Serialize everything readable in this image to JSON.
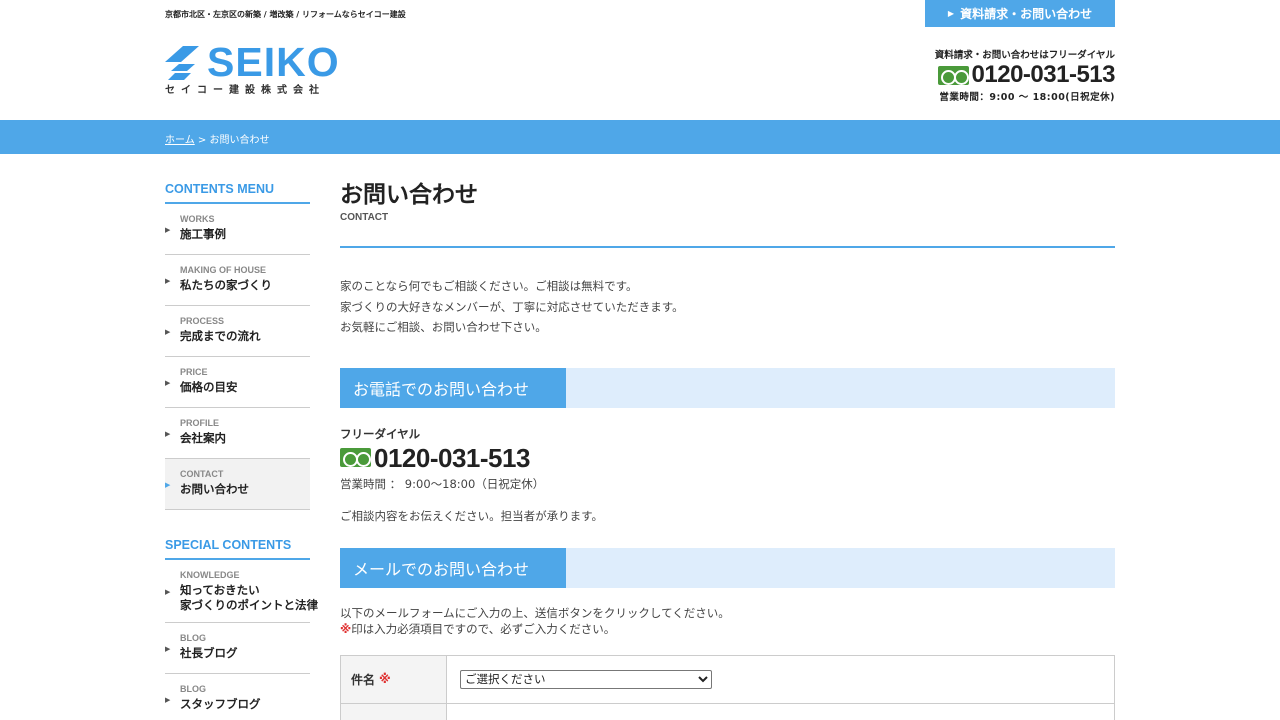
{
  "header": {
    "tagline": "京都市北区・左京区の新築 / 増改築 / リフォームならセイコー建設",
    "logo_word": "SEIKO",
    "logo_sub": "セイコー建設株式会社",
    "cta_button": "資料請求・お問い合わせ",
    "phone_lead": "資料請求・お問い合わせはフリーダイヤル",
    "phone_number": "0120-031-513",
    "phone_hours": "営業時間：9:00 〜 18:00(日祝定休)"
  },
  "breadcrumb": {
    "home": "ホーム",
    "separator": " > ",
    "current": "お問い合わせ"
  },
  "sidebar": {
    "contents_title": "CONTENTS MENU",
    "contents": [
      {
        "en": "WORKS",
        "jp": "施工事例"
      },
      {
        "en": "MAKING OF HOUSE",
        "jp": "私たちの家づくり"
      },
      {
        "en": "PROCESS",
        "jp": "完成までの流れ"
      },
      {
        "en": "PRICE",
        "jp": "価格の目安"
      },
      {
        "en": "PROFILE",
        "jp": "会社案内"
      },
      {
        "en": "CONTACT",
        "jp": "お問い合わせ"
      }
    ],
    "special_title": "SPECIAL CONTENTS",
    "special": [
      {
        "en": "KNOWLEDGE",
        "jp1": "知っておきたい",
        "jp2": "家づくりのポイントと法律"
      },
      {
        "en": "BLOG",
        "jp": "社長ブログ"
      },
      {
        "en": "BLOG",
        "jp": "スタッフブログ"
      }
    ]
  },
  "main": {
    "title": "お問い合わせ",
    "subtitle": "CONTACT",
    "intro": [
      "家のことなら何でもご相談ください。ご相談は無料です。",
      "家づくりの大好きなメンバーが、丁寧に対応させていただきます。",
      "お気軽にご相談、お問い合わせ下さい。"
    ],
    "phone_section": {
      "heading": "お電話でのお問い合わせ",
      "label": "フリーダイヤル",
      "number": "0120-031-513",
      "hours": "営業時間 ： 9:00～18:00（日祝定休）",
      "note": "ご相談内容をお伝えください。担当者が承ります。"
    },
    "mail_section": {
      "heading": "メールでのお問い合わせ",
      "intro1": "以下のメールフォームにご入力の上、送信ボタンをクリックしてください。",
      "req_mark": "※",
      "intro2": "印は入力必須項目ですので、必ずご入力ください。"
    },
    "form": {
      "subject_label": "件名",
      "req_mark": "※",
      "subject_value": "ご選択ください"
    }
  },
  "colors": {
    "accent": "#4fa7e8",
    "accent_light": "#deedfc",
    "freedial_green": "#4a9a3a",
    "required_red": "#e03030"
  }
}
